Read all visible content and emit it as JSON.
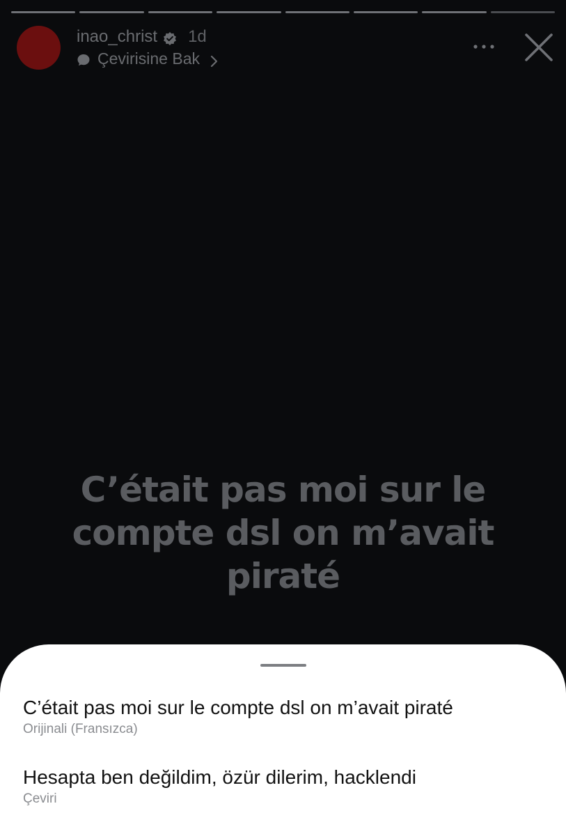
{
  "header": {
    "username": "inao_christ",
    "time": "1d",
    "translate_label": "Çevirisine Bak"
  },
  "icons": {
    "verified": "verified-badge-icon",
    "translate": "speech-bubble-icon",
    "chevron": "chevron-right-icon",
    "more": "more-horizontal-icon",
    "close": "close-icon"
  },
  "progress": {
    "segments": 8,
    "current": 8
  },
  "story": {
    "text": "C’était pas moi sur le compte dsl on m’avait piraté"
  },
  "sheet": {
    "items": [
      {
        "text": "C’était pas moi sur le compte dsl on m’avait piraté",
        "label": "Orijinali (Fransızca)"
      },
      {
        "text": "Hesapta ben değildim, özür dilerim, hacklendi",
        "label": "Çeviri"
      }
    ]
  },
  "colors": {
    "background": "#0a0b0d",
    "avatar": "#6b0f0f",
    "sheet": "#ffffff"
  }
}
